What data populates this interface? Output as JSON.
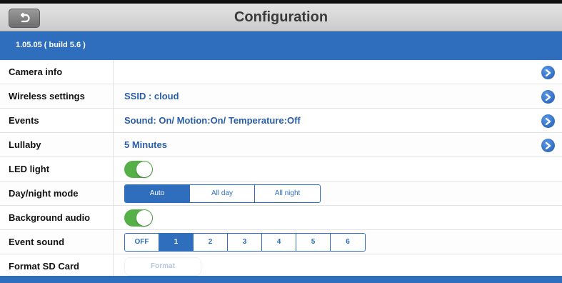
{
  "header": {
    "title": "Configuration",
    "back_icon": "back-arrow-icon"
  },
  "version": "1.05.05 ( build 5.6 )",
  "rows": {
    "camera_info": {
      "label": "Camera info",
      "value": ""
    },
    "wireless": {
      "label": "Wireless settings",
      "value": "SSID : cloud"
    },
    "events": {
      "label": "Events",
      "value": "Sound: On/ Motion:On/ Temperature:Off"
    },
    "lullaby": {
      "label": "Lullaby",
      "value": "5 Minutes"
    },
    "led": {
      "label": "LED light",
      "on": true
    },
    "daynight": {
      "label": "Day/night mode",
      "options": [
        "Auto",
        "All day",
        "All night"
      ],
      "selected": "Auto"
    },
    "bg_audio": {
      "label": "Background audio",
      "on": true
    },
    "event_sound": {
      "label": "Event sound",
      "options": [
        "OFF",
        "1",
        "2",
        "3",
        "4",
        "5",
        "6"
      ],
      "selected": "1"
    },
    "format_sd": {
      "label": "Format SD Card",
      "button": "Format"
    }
  },
  "colors": {
    "accent": "#2f6dbd",
    "toggle_on": "#55b048",
    "value_text": "#2a5ea8"
  }
}
